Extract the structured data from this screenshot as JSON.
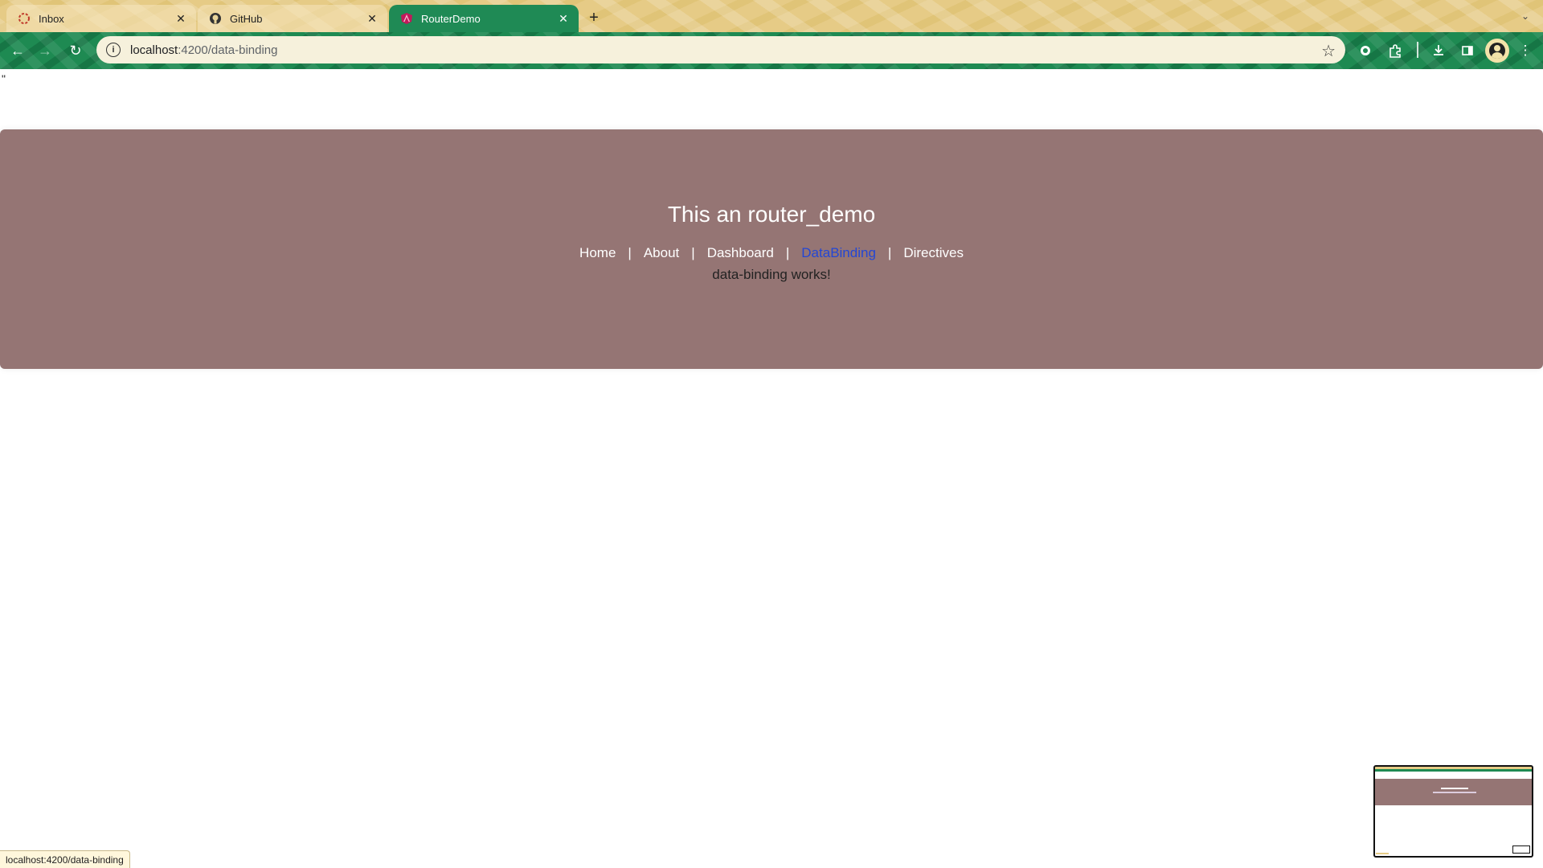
{
  "browser": {
    "tabs": [
      {
        "title": "Inbox",
        "icon": "inbox-favicon-icon",
        "active": false
      },
      {
        "title": "GitHub",
        "icon": "github-icon",
        "active": false
      },
      {
        "title": "RouterDemo",
        "icon": "angular-icon",
        "active": true
      }
    ],
    "address": {
      "host": "localhost",
      "path": ":4200/data-binding"
    },
    "colors": {
      "tabstrip": "#e6cb86",
      "toolbar": "#1e8a52",
      "active_tab": "#1f8a55"
    }
  },
  "page": {
    "stray_text": "\"",
    "heading": "This an router_demo",
    "nav": {
      "items": [
        "Home",
        "About",
        "Dashboard",
        "DataBinding",
        "Directives"
      ],
      "separator": "|",
      "active": "DataBinding"
    },
    "message": "data-binding works!",
    "colors": {
      "hero_bg": "#957574",
      "active_link": "#2447d4"
    }
  },
  "statusbar": {
    "url": "localhost:4200/data-binding"
  }
}
